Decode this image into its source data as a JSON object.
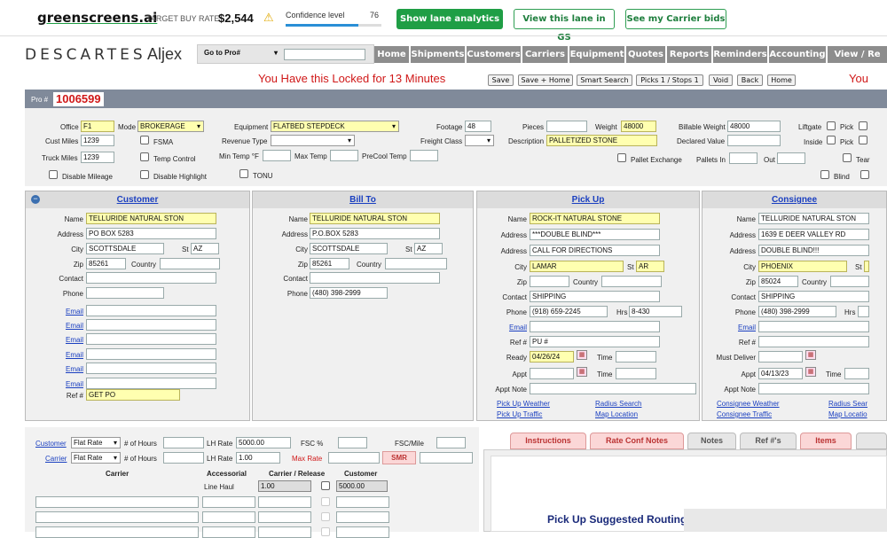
{
  "top_banner": {
    "logo": "greenscreens.ai",
    "target_buy_rate_label": "TARGET BUY RATE",
    "target_buy_rate_value": "$2,544",
    "confidence_label": "Confidence level",
    "confidence_value": "76",
    "confidence_fraction": 0.76,
    "show_lane_analytics": "Show lane analytics",
    "view_lane_gs": "View this lane in GS",
    "see_carrier_bids": "See my Carrier bids"
  },
  "brand": {
    "descartes": "DESCARTES",
    "aljex": "Aljex"
  },
  "goto": {
    "label": "Go to Pro#",
    "value": ""
  },
  "nav": [
    "Home",
    "Shipments",
    "Customers",
    "Carriers",
    "Equipment",
    "Quotes",
    "Reports",
    "Reminders",
    "Accounting",
    "View / Re"
  ],
  "lock_message": "You Have this Locked for 13 Minutes",
  "lock_message_right": "You",
  "actions": [
    "Save",
    "Save + Home",
    "Smart Search",
    "Picks 1 / Stops 1",
    "Void",
    "Back",
    "Home"
  ],
  "pro": {
    "label": "Pro #",
    "value": "1006599"
  },
  "header_fields": {
    "office_label": "Office",
    "office": "F1",
    "mode_label": "Mode",
    "mode": "BROKERAGE",
    "equipment_label": "Equipment",
    "equipment": "FLATBED STEPDECK",
    "footage_label": "Footage",
    "footage": "48",
    "pieces_label": "Pieces",
    "pieces": "",
    "weight_label": "Weight",
    "weight": "48000",
    "billable_weight_label": "Billable Weight",
    "billable_weight": "48000",
    "liftgate_label": "Liftgate",
    "pick_label": "Pick",
    "cust_miles_label": "Cust Miles",
    "cust_miles": "1239",
    "fsma_label": "FSMA",
    "revenue_type_label": "Revenue Type",
    "revenue_type": "",
    "freight_class_label": "Freight Class",
    "freight_class": "",
    "description_label": "Description",
    "description": "PALLETIZED STONE",
    "declared_value_label": "Declared Value",
    "declared_value": "",
    "inside_label": "Inside",
    "truck_miles_label": "Truck Miles",
    "truck_miles": "1239",
    "temp_control_label": "Temp Control",
    "min_temp_label": "Min Temp °F",
    "max_temp_label": "Max Temp",
    "precool_label": "PreCool Temp",
    "pallet_exchange_label": "Pallet Exchange",
    "pallets_in_label": "Pallets In",
    "out_label": "Out",
    "team_label": "Tear",
    "disable_mileage_label": "Disable Mileage",
    "disable_highlight_label": "Disable Highlight",
    "tonu_label": "TONU",
    "blind_label": "Blind"
  },
  "customer": {
    "title": "Customer",
    "name": "TELLURIDE NATURAL STON",
    "address": "PO BOX 5283",
    "city": "SCOTTSDALE",
    "st": "AZ",
    "zip": "85261",
    "country": "",
    "contact": "",
    "phone": "",
    "ref": "GET PO"
  },
  "billto": {
    "title": "Bill To",
    "name": "TELLURIDE NATURAL STON",
    "address": "P.O.BOX 5283",
    "city": "SCOTTSDALE",
    "st": "AZ",
    "zip": "85261",
    "country": "",
    "contact": "",
    "phone": "(480) 398-2999"
  },
  "pickup": {
    "title": "Pick Up",
    "name": "ROCK-IT NATURAL STONE",
    "address": "***DOUBLE BLIND***",
    "address2": "CALL FOR DIRECTIONS",
    "city": "LAMAR",
    "st": "AR",
    "zip": "",
    "country": "",
    "contact": "SHIPPING",
    "phone": "(918) 659-2245",
    "hrs": "8-430",
    "ref": "PU #",
    "ready": "04/26/24",
    "weather": "Pick Up Weather",
    "traffic": "Pick Up Traffic",
    "radius": "Radius Search",
    "map": "Map Location"
  },
  "consignee": {
    "title": "Consignee",
    "name": "TELLURIDE NATURAL STON",
    "address": "1639 E DEER VALLEY RD",
    "address2": "DOUBLE BLIND!!!",
    "city": "PHOENIX",
    "zip": "85024",
    "country": "",
    "contact": "SHIPPING",
    "phone": "(480) 398-2999",
    "appt": "04/13/23",
    "weather": "Consignee Weather",
    "traffic": "Consignee Traffic",
    "radius": "Radius Sear",
    "map": "Map Locatio"
  },
  "labels": {
    "name": "Name",
    "address": "Address",
    "city": "City",
    "st": "St",
    "zip": "Zip",
    "country": "Country",
    "contact": "Contact",
    "phone": "Phone",
    "email": "Email",
    "ref": "Ref #",
    "hrs": "Hrs",
    "ready": "Ready",
    "time": "Time",
    "appt": "Appt",
    "appt_note": "Appt Note",
    "must_deliver": "Must Deliver"
  },
  "rates": {
    "customer_label": "Customer",
    "carrier_label": "Carrier",
    "cust_rate_type": "Flat Rate",
    "carr_rate_type": "Flat Rate",
    "hours_label": "# of Hours",
    "lh_rate_label": "LH Rate",
    "cust_lh": "5000.00",
    "carr_lh": "1.00",
    "fsc_label": "FSC %",
    "fsc_mile_label": "FSC/Mile",
    "max_rate_label": "Max Rate",
    "smr": "SMR",
    "col_carrier": "Carrier",
    "col_accessorial": "Accessorial",
    "col_carrier_release": "Carrier / Release",
    "col_customer": "Customer",
    "line_haul": "Line Haul",
    "line_haul_carrier": "1.00",
    "line_haul_customer": "5000.00"
  },
  "tabs": [
    "Instructions",
    "Rate Conf Notes",
    "Notes",
    "Ref #'s",
    "Items"
  ],
  "routing_title": "Pick Up Suggested Routing",
  "colors": {
    "green": "#1f9e45",
    "nav": "#8d8d8d",
    "red": "#d01818",
    "yellow": "#ffffb0",
    "tab_pink": "#fbd7d7"
  }
}
